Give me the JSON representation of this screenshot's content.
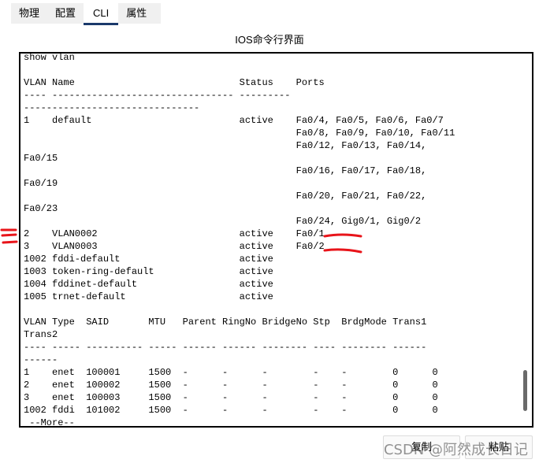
{
  "tabs": [
    {
      "label": "物理"
    },
    {
      "label": "配置"
    },
    {
      "label": "CLI",
      "active": true
    },
    {
      "label": "属性"
    }
  ],
  "panel": {
    "title": "IOS命令行界面"
  },
  "console": {
    "text": "show vlan\n\nVLAN Name                             Status    Ports\n---- -------------------------------- --------- \n-------------------------------\n1    default                          active    Fa0/4, Fa0/5, Fa0/6, Fa0/7\n                                                Fa0/8, Fa0/9, Fa0/10, Fa0/11\n                                                Fa0/12, Fa0/13, Fa0/14,\nFa0/15\n                                                Fa0/16, Fa0/17, Fa0/18,\nFa0/19\n                                                Fa0/20, Fa0/21, Fa0/22,\nFa0/23\n                                                Fa0/24, Gig0/1, Gig0/2\n2    VLAN0002                         active    Fa0/1\n3    VLAN0003                         active    Fa0/2\n1002 fddi-default                     active\n1003 token-ring-default               active\n1004 fddinet-default                  active\n1005 trnet-default                    active\n\nVLAN Type  SAID       MTU   Parent RingNo BridgeNo Stp  BrdgMode Trans1\nTrans2\n---- ----- ---------- ----- ------ ------ -------- ---- -------- ------\n------\n1    enet  100001     1500  -      -      -        -    -        0      0\n2    enet  100002     1500  -      -      -        -    -        0      0\n3    enet  100003     1500  -      -      -        -    -        0      0\n1002 fddi  101002     1500  -      -      -        -    -        0      0\n --More--"
  },
  "buttons": {
    "copy": "复制",
    "paste": "粘贴"
  },
  "watermark": "CSDN @阿然成长日记",
  "colors": {
    "annotation": "#e8141a",
    "tab_underline": "#1b3a6b"
  }
}
